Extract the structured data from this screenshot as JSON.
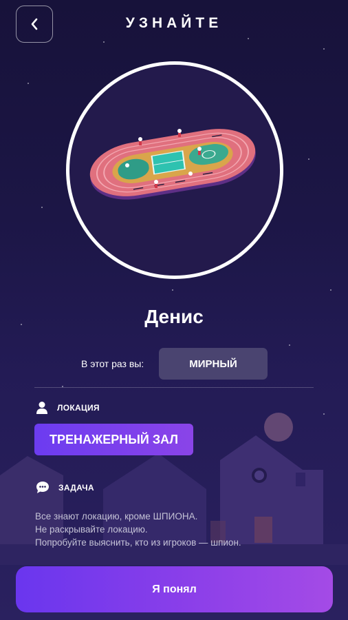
{
  "header": {
    "title": "УЗНАЙТЕ",
    "back_icon": "chevron-left-icon"
  },
  "player": {
    "name": "Денис"
  },
  "role": {
    "prefix": "В этот раз вы:",
    "value": "МИРНЫЙ"
  },
  "location_section": {
    "label": "ЛОКАЦИЯ",
    "icon": "person-icon",
    "value": "ТРЕНАЖЕРНЫЙ ЗАЛ"
  },
  "task_section": {
    "label": "ЗАДАЧА",
    "icon": "chat-bubble-icon",
    "lines": [
      "Все знают локацию, кроме ШПИОНА.",
      "Не раскрывайте локацию.",
      "Попробуйте выяснить, кто из игроков — шпион."
    ]
  },
  "actions": {
    "confirm_label": "Я понял"
  },
  "colors": {
    "accent_start": "#6a36ee",
    "accent_end": "#a44be6",
    "background": "#1c1646",
    "chip": "#4a4470"
  }
}
